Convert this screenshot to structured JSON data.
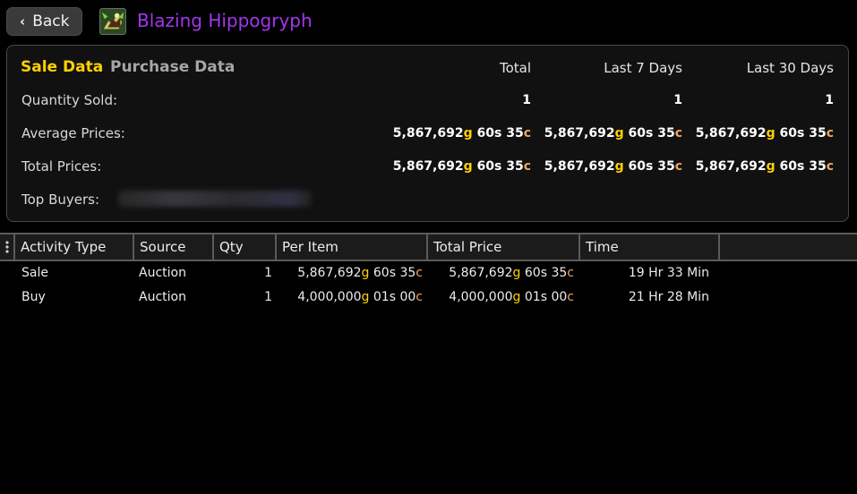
{
  "header": {
    "back_label": "Back",
    "item_name": "Blazing Hippogryph",
    "item_name_color": "#a335ee",
    "item_icon": "mount-icon"
  },
  "summary": {
    "tabs": [
      {
        "label": "Sale Data",
        "active": true
      },
      {
        "label": "Purchase Data",
        "active": false
      }
    ],
    "columns": [
      "Total",
      "Last 7 Days",
      "Last 30 Days"
    ],
    "rows": [
      {
        "label": "Quantity Sold:",
        "values": [
          "1",
          "1",
          "1"
        ]
      },
      {
        "label": "Average Prices:",
        "values": [
          {
            "gold": "5,867,692",
            "silver": "60",
            "copper": "35"
          },
          {
            "gold": "5,867,692",
            "silver": "60",
            "copper": "35"
          },
          {
            "gold": "5,867,692",
            "silver": "60",
            "copper": "35"
          }
        ]
      },
      {
        "label": "Total Prices:",
        "values": [
          {
            "gold": "5,867,692",
            "silver": "60",
            "copper": "35"
          },
          {
            "gold": "5,867,692",
            "silver": "60",
            "copper": "35"
          },
          {
            "gold": "5,867,692",
            "silver": "60",
            "copper": "35"
          }
        ]
      }
    ],
    "top_buyers_label": "Top Buyers:",
    "currency": {
      "gold": "g",
      "silver": "s",
      "copper": "c"
    }
  },
  "activity": {
    "columns": [
      "Activity Type",
      "Source",
      "Qty",
      "Per Item",
      "Total Price",
      "Time"
    ],
    "rows": [
      {
        "type": "Sale",
        "source": "Auction",
        "qty": "1",
        "per_item": {
          "gold": "5,867,692",
          "silver": "60",
          "copper": "35"
        },
        "total": {
          "gold": "5,867,692",
          "silver": "60",
          "copper": "35"
        },
        "time": "19 Hr 33 Min"
      },
      {
        "type": "Buy",
        "source": "Auction",
        "qty": "1",
        "per_item": {
          "gold": "4,000,000",
          "silver": "01",
          "copper": "00"
        },
        "total": {
          "gold": "4,000,000",
          "silver": "01",
          "copper": "00"
        },
        "time": "21 Hr 28 Min"
      }
    ]
  },
  "colors": {
    "gold": "#ffd100",
    "copper": "#eda55f",
    "active_tab": "#ffd100",
    "inactive_tab": "#a6a6a6"
  }
}
